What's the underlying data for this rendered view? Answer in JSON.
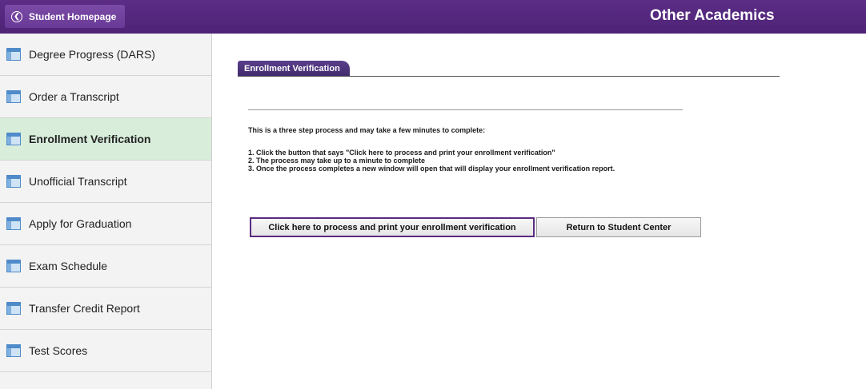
{
  "header": {
    "back_label": "Student Homepage",
    "title": "Other Academics",
    "back_icon": "chevron-left-icon",
    "color": "#4e2376"
  },
  "sidebar": {
    "items": [
      {
        "label": "Degree Progress (DARS)",
        "icon": "page-icon",
        "active": false
      },
      {
        "label": "Order a Transcript",
        "icon": "page-icon",
        "active": false
      },
      {
        "label": "Enrollment Verification",
        "icon": "page-icon",
        "active": true
      },
      {
        "label": "Unofficial Transcript",
        "icon": "page-icon",
        "active": false
      },
      {
        "label": "Apply for Graduation",
        "icon": "page-icon",
        "active": false
      },
      {
        "label": "Exam Schedule",
        "icon": "page-icon",
        "active": false
      },
      {
        "label": "Transfer Credit Report",
        "icon": "page-icon",
        "active": false
      },
      {
        "label": "Test Scores",
        "icon": "page-icon",
        "active": false
      }
    ],
    "active_color": "#d8eedb"
  },
  "main": {
    "tab_label": "Enrollment Verification",
    "intro": "This is a three step process and may take a few minutes to complete:",
    "steps": [
      "1. Click the button that says \"Click here to process and print your enrollment verification\"",
      "2. The process may take up to a minute to complete",
      "3. Once the process completes a new window will open that will display your enrollment verification report."
    ],
    "primary_button": "Click here to process and print your enrollment verification",
    "secondary_button": "Return to Student Center"
  }
}
